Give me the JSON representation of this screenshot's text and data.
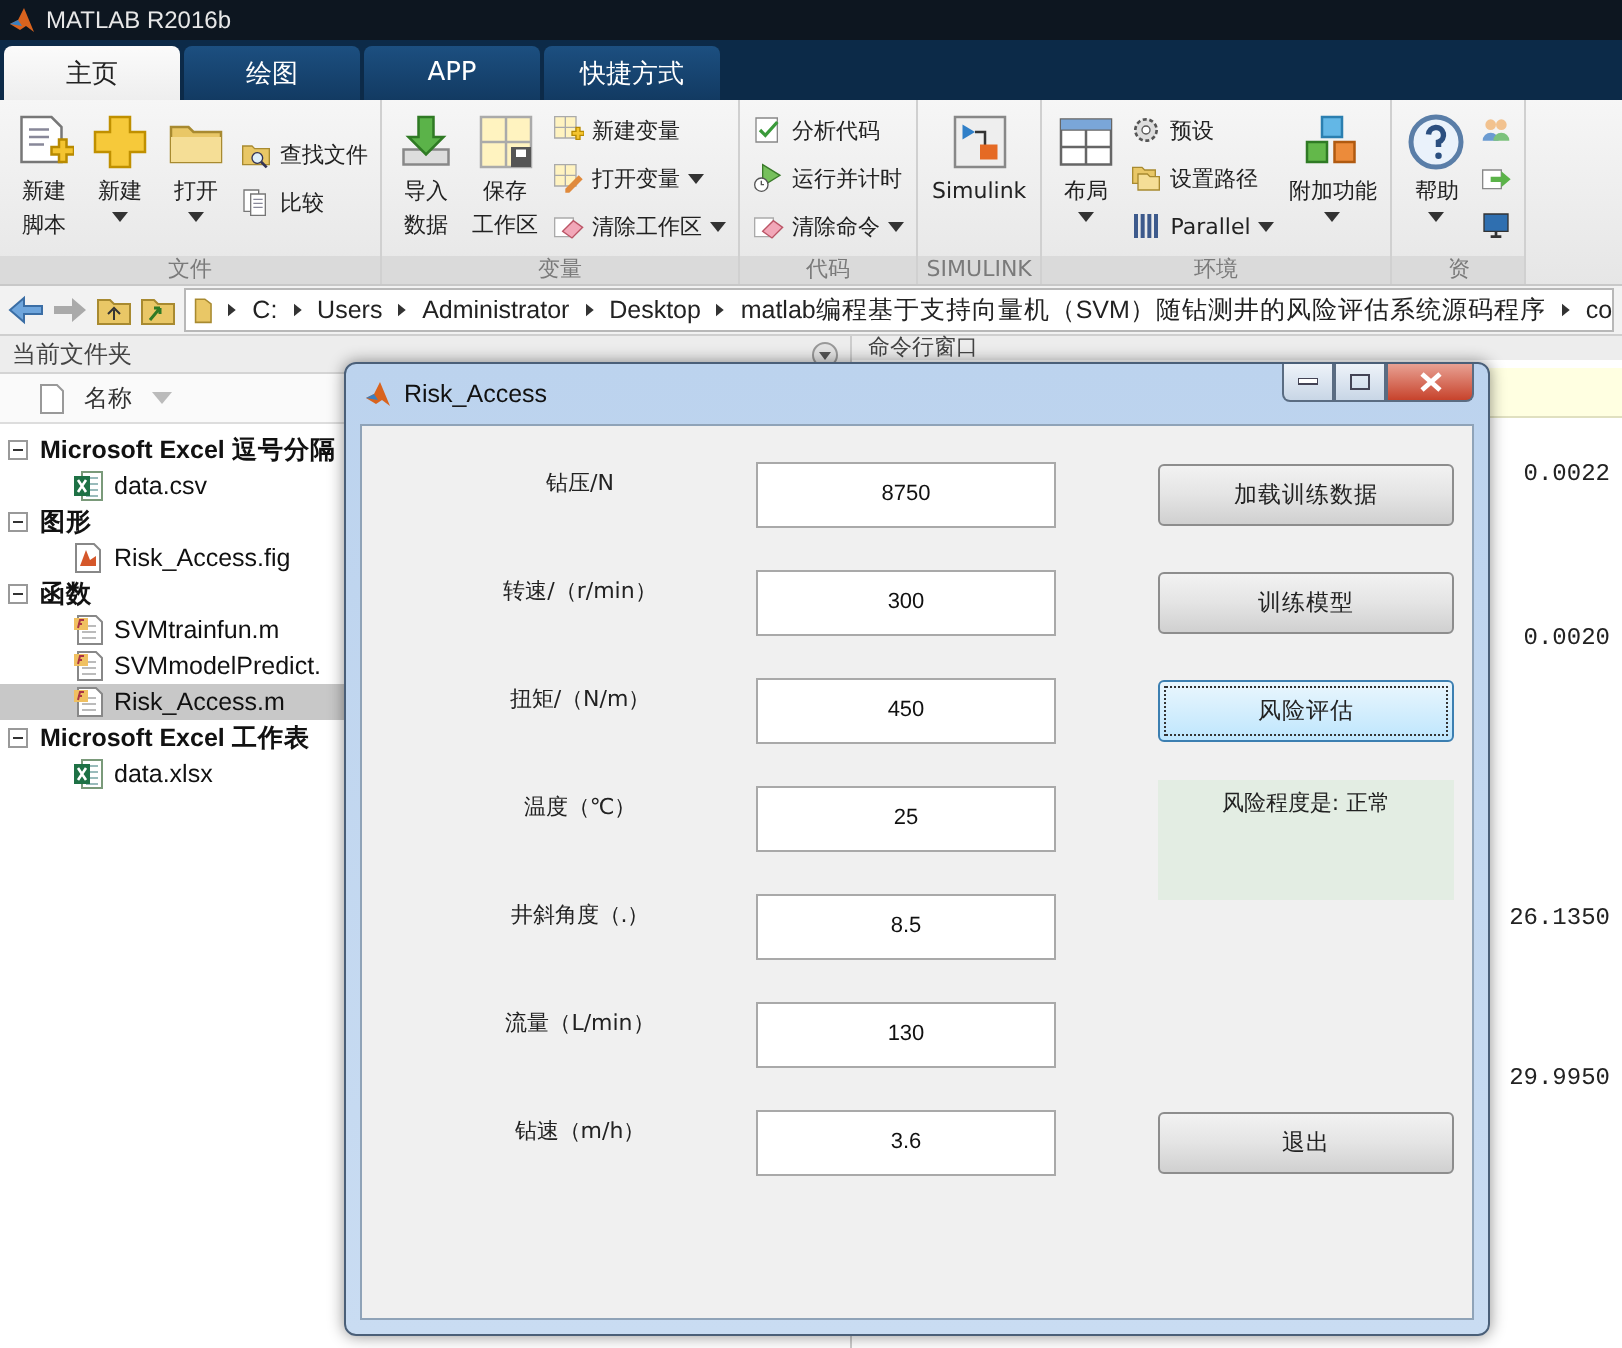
{
  "app_title": "MATLAB R2016b",
  "tabs": [
    {
      "label": "主页",
      "selected": true
    },
    {
      "label": "绘图",
      "selected": false
    },
    {
      "label": "APP",
      "selected": false
    },
    {
      "label": "快捷方式",
      "selected": false
    }
  ],
  "ribbon": [
    {
      "title": "文件",
      "columns": [
        [
          {
            "kind": "large",
            "lines": [
              "新建",
              "脚本"
            ],
            "dropdown": false
          }
        ],
        [
          {
            "kind": "large",
            "label": "新建",
            "dropdown": true
          }
        ],
        [
          {
            "kind": "large",
            "label": "打开",
            "dropdown": true
          }
        ],
        [
          {
            "kind": "small",
            "label": "查找文件",
            "dropdown": false
          },
          {
            "kind": "small",
            "label": "比较",
            "dropdown": false
          }
        ]
      ]
    },
    {
      "title": "变量",
      "columns": [
        [
          {
            "kind": "large",
            "lines": [
              "导入",
              "数据"
            ],
            "dropdown": false
          }
        ],
        [
          {
            "kind": "large",
            "lines": [
              "保存",
              "工作区"
            ],
            "dropdown": false
          }
        ],
        [
          {
            "kind": "small",
            "label": "新建变量",
            "dropdown": false
          },
          {
            "kind": "small",
            "label": "打开变量",
            "dropdown": true
          },
          {
            "kind": "small",
            "label": "清除工作区",
            "dropdown": true
          }
        ]
      ]
    },
    {
      "title": "代码",
      "columns": [
        [
          {
            "kind": "small",
            "label": "分析代码",
            "dropdown": false
          },
          {
            "kind": "small",
            "label": "运行并计时",
            "dropdown": false
          },
          {
            "kind": "small",
            "label": "清除命令",
            "dropdown": true
          }
        ]
      ]
    },
    {
      "title": "SIMULINK",
      "columns": [
        [
          {
            "kind": "large",
            "label": "Simulink",
            "dropdown": false
          }
        ]
      ]
    },
    {
      "title": "环境",
      "columns": [
        [
          {
            "kind": "large",
            "label": "布局",
            "dropdown": true
          }
        ],
        [
          {
            "kind": "small",
            "label": "预设",
            "dropdown": false
          },
          {
            "kind": "small",
            "label": "设置路径",
            "dropdown": false
          },
          {
            "kind": "small",
            "label": "Parallel",
            "dropdown": true
          }
        ],
        [
          {
            "kind": "large",
            "label": "附加功能",
            "dropdown": true
          }
        ]
      ]
    },
    {
      "title": "资",
      "columns": [
        [
          {
            "kind": "large",
            "label": "帮助",
            "dropdown": true
          }
        ],
        [
          {
            "kind": "icon"
          },
          {
            "kind": "icon"
          },
          {
            "kind": "icon"
          }
        ]
      ]
    }
  ],
  "path": [
    "C:",
    "Users",
    "Administrator",
    "Desktop",
    "matlab编程基于支持向量机（SVM）随钻测井的风险评估系统源码程序",
    "co"
  ],
  "files_panel": {
    "title": "当前文件夹",
    "column": "名称",
    "groups": [
      {
        "label": "Microsoft Excel 逗号分隔",
        "expanded": true,
        "children": [
          {
            "name": "data.csv",
            "kind": "spreadsheet",
            "selected": false
          }
        ]
      },
      {
        "label": "图形",
        "expanded": true,
        "children": [
          {
            "name": "Risk_Access.fig",
            "kind": "figure",
            "selected": false
          }
        ]
      },
      {
        "label": "函数",
        "expanded": true,
        "children": [
          {
            "name": "SVMtrainfun.m",
            "kind": "function",
            "selected": false
          },
          {
            "name": "SVMmodelPredict.",
            "kind": "function",
            "selected": false
          },
          {
            "name": "Risk_Access.m",
            "kind": "function",
            "selected": true
          }
        ]
      },
      {
        "label": "Microsoft Excel 工作表",
        "expanded": true,
        "children": [
          {
            "name": "data.xlsx",
            "kind": "spreadsheet",
            "selected": false
          }
        ]
      }
    ]
  },
  "command_window": {
    "title": "命令行窗口",
    "outputs": [
      "0.0022",
      "0.0020",
      "26.1350",
      "29.9950"
    ]
  },
  "dialog": {
    "title": "Risk_Access",
    "fields": [
      {
        "label": "钻压/N",
        "value": "8750"
      },
      {
        "label": "转速/（r/min）",
        "value": "300"
      },
      {
        "label": "扭矩/（N/m）",
        "value": "450"
      },
      {
        "label": "温度（℃）",
        "value": "25"
      },
      {
        "label": "井斜角度（.）",
        "value": "8.5"
      },
      {
        "label": "流量（L/min）",
        "value": "130"
      },
      {
        "label": "钻速（m/h）",
        "value": "3.6"
      }
    ],
    "buttons": [
      {
        "label": "加载训练数据",
        "focused": false
      },
      {
        "label": "训练模型",
        "focused": false
      },
      {
        "label": "风险评估",
        "focused": true
      },
      {
        "label": "退出",
        "focused": false
      }
    ],
    "result": "风险程度是: 正常"
  }
}
